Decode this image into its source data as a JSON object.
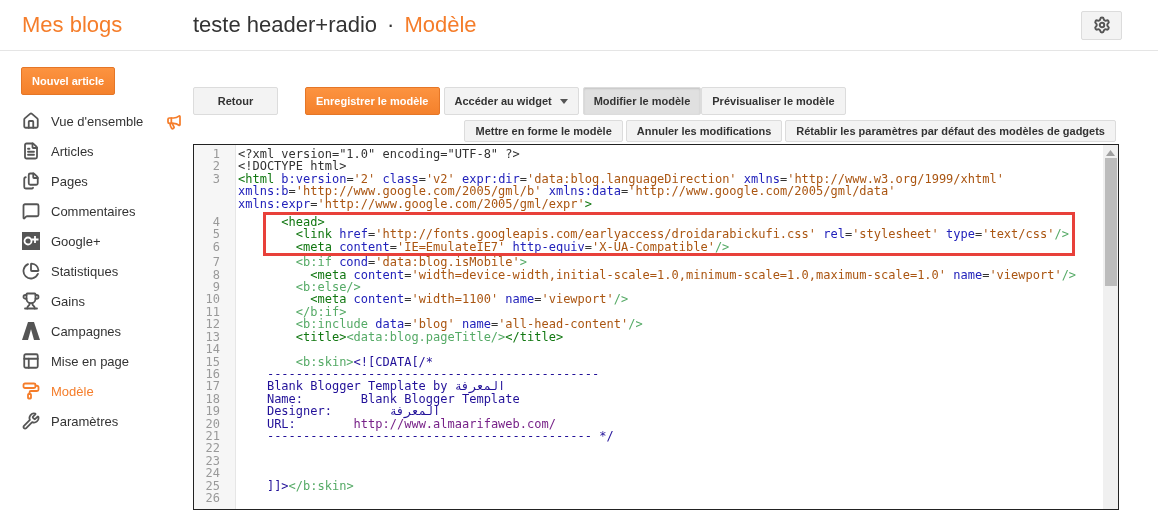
{
  "header": {
    "brand": "Mes blogs",
    "blog_title": "teste header+radio",
    "separator": "·",
    "page_title": "Modèle"
  },
  "sidebar": {
    "new_post": "Nouvel article",
    "items": [
      {
        "label": "Vue d'ensemble",
        "selected": false,
        "notice": true
      },
      {
        "label": "Articles",
        "selected": false,
        "notice": false
      },
      {
        "label": "Pages",
        "selected": false,
        "notice": false
      },
      {
        "label": "Commentaires",
        "selected": false,
        "notice": false
      },
      {
        "label": "Google+",
        "selected": false,
        "notice": false
      },
      {
        "label": "Statistiques",
        "selected": false,
        "notice": false
      },
      {
        "label": "Gains",
        "selected": false,
        "notice": false
      },
      {
        "label": "Campagnes",
        "selected": false,
        "notice": false
      },
      {
        "label": "Mise en page",
        "selected": false,
        "notice": false
      },
      {
        "label": "Modèle",
        "selected": true,
        "notice": false
      },
      {
        "label": "Paramètres",
        "selected": false,
        "notice": false
      }
    ]
  },
  "toolbar": {
    "back": "Retour",
    "save": "Enregistrer le modèle",
    "widget_menu": "Accéder au widget",
    "mode_tabs": [
      {
        "label": "Modifier le modèle",
        "selected": true
      },
      {
        "label": "Prévisualiser le modèle",
        "selected": false
      }
    ]
  },
  "editor_actions": [
    "Mettre en forme le modèle",
    "Annuler les modifications",
    "Rétablir les paramètres par défaut des modèles de gadgets"
  ],
  "code_lines": [
    {
      "number": "1",
      "highlighted": false,
      "segments": [
        {
          "text": "<?xml version=\"1.0\" encoding=\"UTF-8\" ?>",
          "kind": "plain"
        }
      ]
    },
    {
      "number": "2",
      "highlighted": false,
      "segments": [
        {
          "text": "<!DOCTYPE html>",
          "kind": "plain"
        }
      ]
    },
    {
      "number": "3",
      "highlighted": false,
      "segments": [
        {
          "text": "<html",
          "kind": "tag"
        },
        {
          "text": " b:version",
          "kind": "attr"
        },
        {
          "text": "=",
          "kind": "plain"
        },
        {
          "text": "'2'",
          "kind": "value"
        },
        {
          "text": " class",
          "kind": "attr"
        },
        {
          "text": "=",
          "kind": "plain"
        },
        {
          "text": "'v2'",
          "kind": "value"
        },
        {
          "text": " expr:dir",
          "kind": "attr"
        },
        {
          "text": "=",
          "kind": "plain"
        },
        {
          "text": "'data:blog.languageDirection'",
          "kind": "value"
        },
        {
          "text": " xmlns",
          "kind": "attr"
        },
        {
          "text": "=",
          "kind": "plain"
        },
        {
          "text": "'http://www.w3.org/1999/xhtml'",
          "kind": "value"
        },
        {
          "text": " xmlns:b",
          "kind": "attr"
        },
        {
          "text": "=",
          "kind": "plain"
        },
        {
          "text": "'http://www.google.com/2005/gml/b'",
          "kind": "value"
        },
        {
          "text": " xmlns:data",
          "kind": "attr"
        },
        {
          "text": "=",
          "kind": "plain"
        },
        {
          "text": "'http://www.google.com/2005/gml/data'",
          "kind": "value"
        },
        {
          "text": " xmlns:expr",
          "kind": "attr"
        },
        {
          "text": "=",
          "kind": "plain"
        },
        {
          "text": "'http://www.google.com/2005/gml/expr'",
          "kind": "value"
        },
        {
          "text": ">",
          "kind": "tag"
        }
      ]
    },
    {
      "number": "4",
      "highlighted": true,
      "segments": [
        {
          "text": "      <head>",
          "kind": "tag"
        }
      ]
    },
    {
      "number": "5",
      "highlighted": true,
      "segments": [
        {
          "text": "        <link",
          "kind": "tag"
        },
        {
          "text": " href",
          "kind": "attr"
        },
        {
          "text": "=",
          "kind": "plain"
        },
        {
          "text": "'http://fonts.googleapis.com/earlyaccess/droidarabickufi.css'",
          "kind": "value"
        },
        {
          "text": " rel",
          "kind": "attr"
        },
        {
          "text": "=",
          "kind": "plain"
        },
        {
          "text": "'stylesheet'",
          "kind": "value"
        },
        {
          "text": " type",
          "kind": "attr"
        },
        {
          "text": "=",
          "kind": "plain"
        },
        {
          "text": "'text/css'",
          "kind": "value"
        },
        {
          "text": "/>",
          "kind": "btag"
        }
      ]
    },
    {
      "number": "6",
      "highlighted": true,
      "segments": [
        {
          "text": "        <meta",
          "kind": "tag"
        },
        {
          "text": " content",
          "kind": "attr"
        },
        {
          "text": "=",
          "kind": "plain"
        },
        {
          "text": "'IE=EmulateIE7'",
          "kind": "value"
        },
        {
          "text": " http-equiv",
          "kind": "attr"
        },
        {
          "text": "=",
          "kind": "plain"
        },
        {
          "text": "'X-UA-Compatible'",
          "kind": "value"
        },
        {
          "text": "/>",
          "kind": "btag"
        }
      ]
    },
    {
      "number": "7",
      "highlighted": false,
      "segments": [
        {
          "text": "        <b:if",
          "kind": "btag"
        },
        {
          "text": " cond",
          "kind": "attr"
        },
        {
          "text": "=",
          "kind": "plain"
        },
        {
          "text": "'data:blog.isMobile'",
          "kind": "value"
        },
        {
          "text": ">",
          "kind": "btag"
        }
      ]
    },
    {
      "number": "8",
      "highlighted": false,
      "segments": [
        {
          "text": "          <meta",
          "kind": "tag"
        },
        {
          "text": " content",
          "kind": "attr"
        },
        {
          "text": "=",
          "kind": "plain"
        },
        {
          "text": "'width=device-width,initial-scale=1.0,minimum-scale=1.0,maximum-scale=1.0'",
          "kind": "value"
        },
        {
          "text": " name",
          "kind": "attr"
        },
        {
          "text": "=",
          "kind": "plain"
        },
        {
          "text": "'viewport'",
          "kind": "value"
        },
        {
          "text": "/>",
          "kind": "btag"
        }
      ]
    },
    {
      "number": "9",
      "highlighted": false,
      "segments": [
        {
          "text": "        <b:else/>",
          "kind": "btag"
        }
      ]
    },
    {
      "number": "10",
      "highlighted": false,
      "segments": [
        {
          "text": "          <meta",
          "kind": "tag"
        },
        {
          "text": " content",
          "kind": "attr"
        },
        {
          "text": "=",
          "kind": "plain"
        },
        {
          "text": "'width=1100'",
          "kind": "value"
        },
        {
          "text": " name",
          "kind": "attr"
        },
        {
          "text": "=",
          "kind": "plain"
        },
        {
          "text": "'viewport'",
          "kind": "value"
        },
        {
          "text": "/>",
          "kind": "btag"
        }
      ]
    },
    {
      "number": "11",
      "highlighted": false,
      "segments": [
        {
          "text": "        </b:if>",
          "kind": "btag"
        }
      ]
    },
    {
      "number": "12",
      "highlighted": false,
      "segments": [
        {
          "text": "        <b:include",
          "kind": "btag"
        },
        {
          "text": " data",
          "kind": "attr"
        },
        {
          "text": "=",
          "kind": "plain"
        },
        {
          "text": "'blog'",
          "kind": "value"
        },
        {
          "text": " name",
          "kind": "attr"
        },
        {
          "text": "=",
          "kind": "plain"
        },
        {
          "text": "'all-head-content'",
          "kind": "value"
        },
        {
          "text": "/>",
          "kind": "btag"
        }
      ]
    },
    {
      "number": "13",
      "highlighted": false,
      "segments": [
        {
          "text": "        <title>",
          "kind": "tag"
        },
        {
          "text": "<data:blog.pageTitle/>",
          "kind": "btag"
        },
        {
          "text": "</title>",
          "kind": "tag"
        }
      ]
    },
    {
      "number": "14",
      "highlighted": false
    },
    {
      "number": "15",
      "highlighted": false,
      "segments": [
        {
          "text": "        <b:skin>",
          "kind": "btag"
        },
        {
          "text": "<![CDATA[/*",
          "kind": "comment"
        }
      ]
    },
    {
      "number": "16",
      "highlighted": false,
      "segments": [
        {
          "text": "    ----------------------------------------------",
          "kind": "comment"
        }
      ]
    },
    {
      "number": "17",
      "highlighted": false,
      "segments": [
        {
          "text": "    Blank Blogger Template by المعرفة",
          "kind": "comment"
        }
      ]
    },
    {
      "number": "18",
      "highlighted": false,
      "segments": [
        {
          "text": "    Name:        Blank Blogger Template",
          "kind": "comment"
        }
      ]
    },
    {
      "number": "19",
      "highlighted": false,
      "segments": [
        {
          "text": "    Designer:        المعرفة",
          "kind": "comment"
        }
      ]
    },
    {
      "number": "20",
      "highlighted": false,
      "segments": [
        {
          "text": "    URL:        ",
          "kind": "comment"
        },
        {
          "text": "http://www.almaarifaweb.com/",
          "kind": "url"
        }
      ]
    },
    {
      "number": "21",
      "highlighted": false,
      "segments": [
        {
          "text": "    --------------------------------------------- */",
          "kind": "comment"
        }
      ]
    },
    {
      "number": "22",
      "highlighted": false
    },
    {
      "number": "23",
      "highlighted": false
    },
    {
      "number": "24",
      "highlighted": false
    },
    {
      "number": "25",
      "highlighted": false,
      "segments": [
        {
          "text": "    ]]>",
          "kind": "comment"
        },
        {
          "text": "</b:skin>",
          "kind": "btag"
        }
      ]
    },
    {
      "number": "26",
      "highlighted": false
    }
  ]
}
